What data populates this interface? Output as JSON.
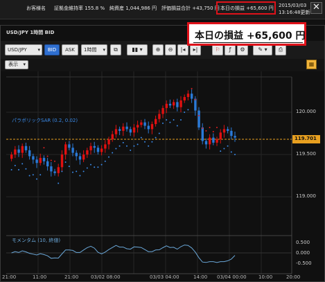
{
  "topbar": {
    "account_label": "お客様名",
    "margin_ratio": "証拠金維持率 155.8 %",
    "net_assets": "純資産 1,044,986 円",
    "valuation": "評価損益合計 +43,750 円",
    "daily_pl": "本日の損益 +65,600 円",
    "date": "2015/03/03",
    "time_updated": "13:16:48更新",
    "close_label": "✕"
  },
  "window": {
    "title": "USD/JPY 1時間 BID"
  },
  "toolbar": {
    "symbol": "USD/JPY",
    "bid": "BID",
    "ask": "ASK",
    "interval": "1時間"
  },
  "row2": {
    "show_label": "表示"
  },
  "callout": {
    "text": "本日の損益 +65,600 円"
  },
  "chart": {
    "sar_label": "パラボリックSAR (0.2, 0.02)",
    "momentum_label": "モメンタム (10, 終値)",
    "current_price": "119.701",
    "price_labels": [
      "120.000",
      "119.500",
      "119.000"
    ],
    "mom_labels": [
      "0.500",
      "0.000",
      "-0.500"
    ],
    "time_labels": [
      "21:00",
      "11:00",
      "21:00",
      "03/02 08:00",
      "03/03 04:00",
      "14:00",
      "03/04 00:00",
      "10:00",
      "20:00"
    ]
  },
  "chart_data": {
    "type": "candlestick",
    "series": [
      {
        "name": "USD/JPY",
        "note": "hourly candles with Parabolic SAR"
      }
    ],
    "price_ticks": [
      120.0,
      119.5,
      119.0
    ],
    "current_price": 119.701,
    "momentum_ticks": [
      0.5,
      0.0,
      -0.5
    ],
    "colors": {
      "up": "#e01010",
      "down": "#2a7ad8",
      "sar_down": "#e02020",
      "sar_up": "#3a8ae8",
      "current_line": "#e8a020",
      "momentum": "#6aa7d8"
    }
  }
}
